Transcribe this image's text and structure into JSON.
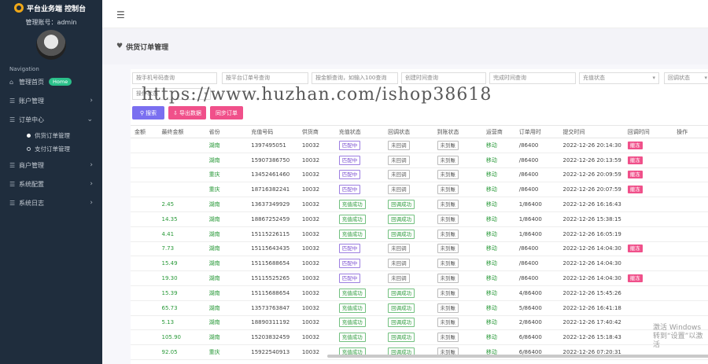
{
  "brand": {
    "title": "平台业务端 控制台"
  },
  "account": {
    "label": "管理账号：admin"
  },
  "sidebar": {
    "caption": "Navigation",
    "items": [
      {
        "label": "管理首页",
        "icon": "home-icon",
        "badge": "Home"
      },
      {
        "label": "账户管理",
        "icon": "menu-icon"
      },
      {
        "label": "订单中心",
        "icon": "menu-icon",
        "expanded": true,
        "children": [
          {
            "label": "供货订单管理",
            "active": true
          },
          {
            "label": "支付订单管理"
          }
        ]
      },
      {
        "label": "商户管理",
        "icon": "menu-icon"
      },
      {
        "label": "系统配置",
        "icon": "menu-icon"
      },
      {
        "label": "系统日志",
        "icon": "menu-icon"
      }
    ]
  },
  "page": {
    "title": "供货订单管理"
  },
  "filters": {
    "f1": "按手机号码查询",
    "f2": "按平台订单号查询",
    "f3": "按金额查询，如输入100查询",
    "f4": "创建时间查询",
    "f5": "完成时间查询",
    "f6": "充值状态",
    "f7": "回调状态",
    "f8": "操作状态"
  },
  "buttons": {
    "search": "搜索",
    "export": "导出数据",
    "sync": "同步订单"
  },
  "table": {
    "headers": [
      "金额",
      "最终金额",
      "省份",
      "充值号码",
      "供货商",
      "充值状态",
      "回调状态",
      "到账状态",
      "运营商",
      "订单用时",
      "提交时间",
      "回调时间",
      "操作"
    ],
    "rows": [
      {
        "amount": "",
        "final": "",
        "prov": "湖南",
        "phone": "1397495051",
        "sup": "10032",
        "charge": "匹配中",
        "cb": "未回调",
        "arr": "未到账",
        "op": "移动",
        "dur": "/86400",
        "sub": "2022-12-26 20:14:30",
        "cbt": "撤冻"
      },
      {
        "amount": "",
        "final": "",
        "prov": "湖南",
        "phone": "15907386750",
        "sup": "10032",
        "charge": "匹配中",
        "cb": "未回调",
        "arr": "未到账",
        "op": "移动",
        "dur": "/86400",
        "sub": "2022-12-26 20:13:59",
        "cbt": "撤冻"
      },
      {
        "amount": "",
        "final": "",
        "prov": "重庆",
        "phone": "13452461460",
        "sup": "10032",
        "charge": "匹配中",
        "cb": "未回调",
        "arr": "未到账",
        "op": "移动",
        "dur": "/86400",
        "sub": "2022-12-26 20:09:59",
        "cbt": "撤冻"
      },
      {
        "amount": "",
        "final": "",
        "prov": "重庆",
        "phone": "18716382241",
        "sup": "10032",
        "charge": "匹配中",
        "cb": "未回调",
        "arr": "未到账",
        "op": "移动",
        "dur": "/86400",
        "sub": "2022-12-26 20:07:59",
        "cbt": "撤冻"
      },
      {
        "amount": "",
        "final": "2.45",
        "prov": "湖南",
        "phone": "13637349929",
        "sup": "10032",
        "charge": "充值成功",
        "cb": "回调成功",
        "arr": "未到账",
        "op": "移动",
        "dur": "1/86400",
        "sub": "2022-12-26 16:16:43",
        "cbt": ""
      },
      {
        "amount": "",
        "final": "14.35",
        "prov": "湖南",
        "phone": "18867252459",
        "sup": "10032",
        "charge": "充值成功",
        "cb": "回调成功",
        "arr": "未到账",
        "op": "移动",
        "dur": "1/86400",
        "sub": "2022-12-26 15:38:15",
        "cbt": ""
      },
      {
        "amount": "",
        "final": "4.41",
        "prov": "湖南",
        "phone": "15115226115",
        "sup": "10032",
        "charge": "充值成功",
        "cb": "回调成功",
        "arr": "未到账",
        "op": "移动",
        "dur": "1/86400",
        "sub": "2022-12-26 16:05:19",
        "cbt": ""
      },
      {
        "amount": "",
        "final": "7.73",
        "prov": "湖南",
        "phone": "15115643435",
        "sup": "10032",
        "charge": "匹配中",
        "cb": "未回调",
        "arr": "未到账",
        "op": "移动",
        "dur": "/86400",
        "sub": "2022-12-26 14:04:30",
        "cbt": "撤冻"
      },
      {
        "amount": "",
        "final": "15.49",
        "prov": "湖南",
        "phone": "15115688654",
        "sup": "10032",
        "charge": "匹配中",
        "cb": "未回调",
        "arr": "未到账",
        "op": "移动",
        "dur": "/86400",
        "sub": "2022-12-26 14:04:30",
        "cbt": ""
      },
      {
        "amount": "",
        "final": "19.30",
        "prov": "湖南",
        "phone": "15115525265",
        "sup": "10032",
        "charge": "匹配中",
        "cb": "未回调",
        "arr": "未到账",
        "op": "移动",
        "dur": "/86400",
        "sub": "2022-12-26 14:04:30",
        "cbt": "撤冻"
      },
      {
        "amount": "",
        "final": "15.39",
        "prov": "湖南",
        "phone": "15115688654",
        "sup": "10032",
        "charge": "充值成功",
        "cb": "回调成功",
        "arr": "未到账",
        "op": "移动",
        "dur": "4/86400",
        "sub": "2022-12-26 15:45:26",
        "cbt": ""
      },
      {
        "amount": "",
        "final": "65.73",
        "prov": "湖南",
        "phone": "13573763847",
        "sup": "10032",
        "charge": "充值成功",
        "cb": "回调成功",
        "arr": "未到账",
        "op": "移动",
        "dur": "5/86400",
        "sub": "2022-12-26 16:41:18",
        "cbt": ""
      },
      {
        "amount": "",
        "final": "5.13",
        "prov": "湖南",
        "phone": "18890311192",
        "sup": "10032",
        "charge": "充值成功",
        "cb": "回调成功",
        "arr": "未到账",
        "op": "移动",
        "dur": "2/86400",
        "sub": "2022-12-26 17:40:42",
        "cbt": ""
      },
      {
        "amount": "",
        "final": "105.90",
        "prov": "湖南",
        "phone": "15203832459",
        "sup": "10032",
        "charge": "充值成功",
        "cb": "回调成功",
        "arr": "未到账",
        "op": "移动",
        "dur": "6/86400",
        "sub": "2022-12-26 15:18:43",
        "cbt": ""
      },
      {
        "amount": "",
        "final": "92.05",
        "prov": "重庆",
        "phone": "15922540913",
        "sup": "10032",
        "charge": "充值成功",
        "cb": "回调成功",
        "arr": "未到账",
        "op": "移动",
        "dur": "6/86400",
        "sub": "2022-12-26 07:20:31",
        "cbt": ""
      }
    ]
  },
  "watermark": "https://www.huzhan.com/ishop38618",
  "windows_notice": "激活 Windows 转到“设置”以激活"
}
